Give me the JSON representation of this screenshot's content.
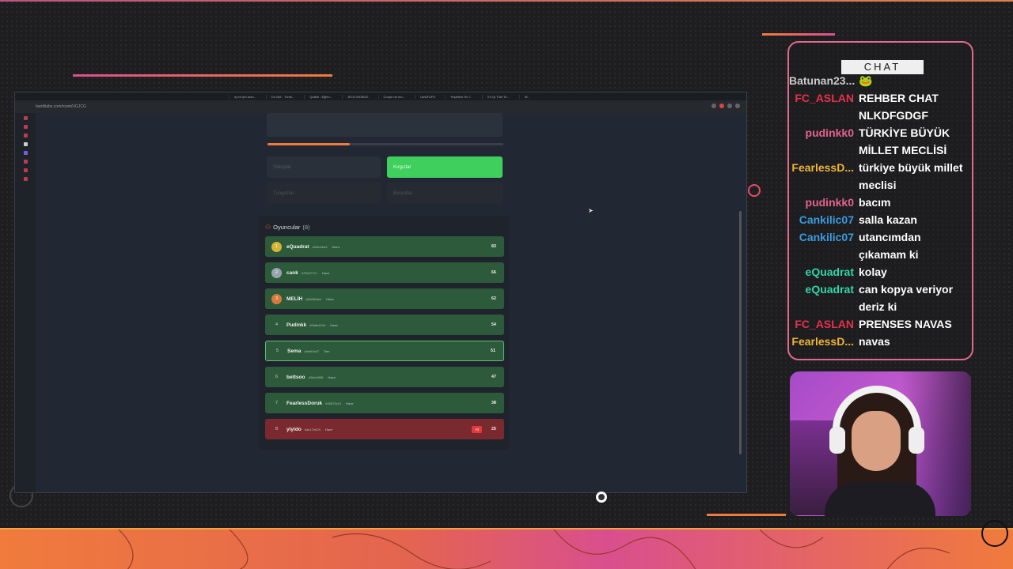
{
  "browser": {
    "tabs": [
      "oy bi için aran...",
      "Do Not - Tumb...",
      "Quibbl - Eğlen...",
      "JEUX MOBILE",
      "Coupe du mo...",
      "UwUFUFU",
      "Yeşeltme En İ...",
      "En İyi Türk To...",
      "W..."
    ],
    "address": "baniblabs.com/room/UGJCG",
    "progress_percent": 35
  },
  "quiz": {
    "options": [
      "Yokuşlar",
      "Kırgızlar",
      "Tunguzlar",
      "Buryatlar"
    ]
  },
  "players": {
    "header_label": "Oyuncular",
    "count_label": "(8)",
    "rows": [
      {
        "rank": "1",
        "name": "eQuadrat",
        "meta": "#9f4b4ba3",
        "status": "Hazır",
        "score": "83"
      },
      {
        "rank": "2",
        "name": "cank",
        "meta": "#76547721",
        "status": "Hazır",
        "score": "66"
      },
      {
        "rank": "3",
        "name": "MELİH",
        "meta": "#8d2884ee",
        "status": "Hazır",
        "score": "62"
      },
      {
        "rank": "4",
        "name": "Pudinkk",
        "meta": "#0b8e4244",
        "status": "Hazır",
        "score": "54"
      },
      {
        "rank": "5",
        "name": "Sema",
        "meta": "#9e6f4a07",
        "status": "Sen",
        "score": "51"
      },
      {
        "rank": "6",
        "name": "bettsoo",
        "meta": "#34e0d0f6",
        "status": "Hazır",
        "score": "47"
      },
      {
        "rank": "7",
        "name": "FearlessDoruk",
        "meta": "#36572e21",
        "status": "Hazır",
        "score": "38"
      },
      {
        "rank": "8",
        "name": "yiyido",
        "meta": "#ae17e629",
        "status": "Hazır",
        "score": "25",
        "badge": "+0"
      }
    ]
  },
  "chat": {
    "title": "CHAT",
    "messages": [
      {
        "user": "Batunan23...",
        "text": "🐸",
        "color": "grey"
      },
      {
        "user": "FC_ASLAN",
        "text": "REHBER CHAT NLKDFGDGF",
        "color": "red"
      },
      {
        "user": "pudinkk0",
        "text": "TÜRKİYE BÜYÜK MİLLET MECLİSİ",
        "color": "pink"
      },
      {
        "user": "FearlessD...",
        "text": "türkiye büyük millet meclisi",
        "color": "yellow"
      },
      {
        "user": "pudinkk0",
        "text": "bacım",
        "color": "pink"
      },
      {
        "user": "Cankilic07",
        "text": "salla kazan",
        "color": "blue"
      },
      {
        "user": "Cankilic07",
        "text": "utancımdan çıkamam ki",
        "color": "blue"
      },
      {
        "user": "eQuadrat",
        "text": "kolay",
        "color": "teal"
      },
      {
        "user": "eQuadrat",
        "text": "can kopya veriyor deriz ki",
        "color": "teal"
      },
      {
        "user": "FC_ASLAN",
        "text": "PRENSES NAVAS",
        "color": "red"
      },
      {
        "user": "FearlessD...",
        "text": "navas",
        "color": "yellow"
      }
    ]
  },
  "colors": {
    "accent_orange": "#f07b3c",
    "accent_pink": "#d94f8e",
    "correct_green": "#3ecf5c",
    "player_row": "#2d5a3a"
  }
}
